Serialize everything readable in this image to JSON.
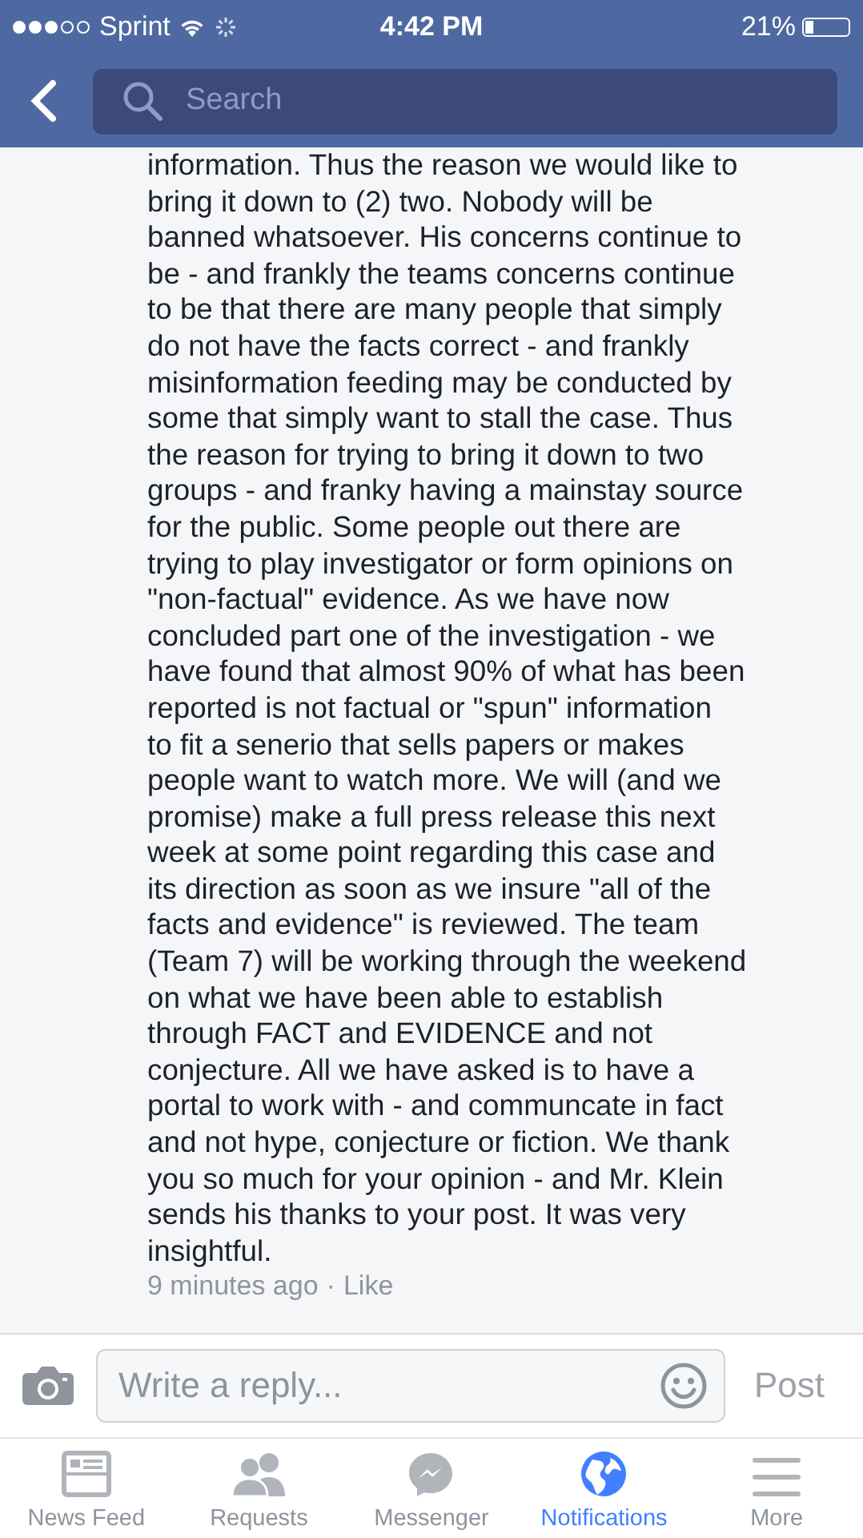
{
  "status_bar": {
    "carrier": "Sprint",
    "time": "4:42 PM",
    "battery": "21%"
  },
  "nav": {
    "search": {
      "placeholder": "Search"
    }
  },
  "comment": {
    "lines": [
      "information. Thus the reason we would like to",
      "bring it down to (2) two. Nobody will be",
      "banned whatsoever. His concerns continue to",
      "be - and frankly the teams concerns continue",
      "to be that there are many people that simply",
      "do not have the facts correct - and frankly",
      "misinformation feeding may be conducted by",
      "some that simply want to stall the case. Thus",
      "the reason for trying to bring it down to two",
      "groups - and franky having a mainstay source",
      "for the public. Some people out there are",
      "trying to play investigator or form opinions on",
      "\"non-factual\" evidence. As we have now",
      "concluded part one of the investigation - we",
      "have found that almost 90% of what has been",
      "reported is not factual or \"spun\" information",
      "to fit a senerio that sells papers or makes",
      "people want to watch more. We will (and we",
      "promise) make a full press release this next",
      "week at some point regarding this case and",
      "its direction as soon as we insure \"all of the",
      "facts and evidence\" is reviewed. The team",
      "(Team 7) will be working through the weekend",
      "on what we have been able to establish",
      "through FACT and EVIDENCE and not",
      "conjecture. All we have asked is to have a",
      "portal to work with - and communcate in fact",
      "and not hype, conjecture or fiction. We thank",
      "you so much for your opinion - and Mr. Klein",
      "sends his thanks to your post. It was very",
      "insightful."
    ],
    "time": "9 minutes ago",
    "separator": "·",
    "like": "Like"
  },
  "reply": {
    "placeholder": "Write a reply...",
    "post": "Post",
    "post_disabled": true
  },
  "tabs": [
    {
      "kind": "feed",
      "label": "News Feed",
      "selected": false
    },
    {
      "kind": "requests",
      "label": "Requests",
      "selected": false
    },
    {
      "kind": "messenger",
      "label": "Messenger",
      "selected": false
    },
    {
      "kind": "notifications",
      "label": "Notifications",
      "selected": true
    },
    {
      "kind": "more",
      "label": "More",
      "selected": false
    }
  ]
}
